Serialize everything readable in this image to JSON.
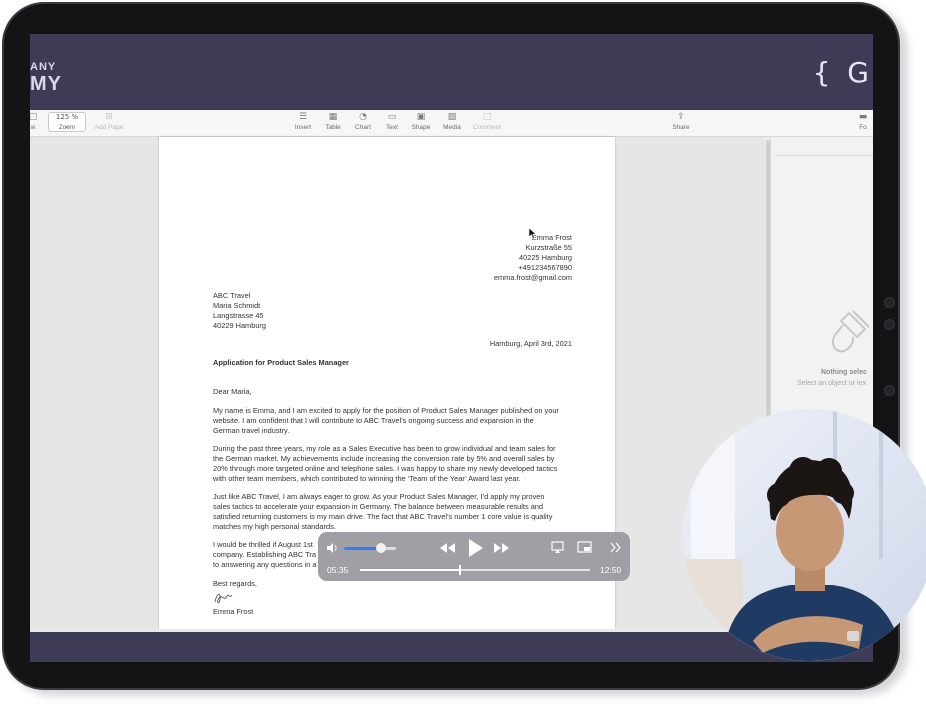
{
  "brand": {
    "left_line1": "ANY",
    "left_line2": "MY",
    "right_glyphs": "{ G"
  },
  "toolbar": {
    "zoom_value": "125 % ⌄",
    "items": [
      {
        "key": "view",
        "label": "w",
        "icon": "sidebar-icon",
        "glyph": "▢"
      },
      {
        "key": "zoom",
        "label": "Zoom",
        "icon": "zoom-select"
      },
      {
        "key": "add_page",
        "label": "Add Page",
        "icon": "add-page-icon",
        "glyph": "⊞",
        "disabled": true
      },
      {
        "key": "insert",
        "label": "Insert",
        "icon": "insert-icon",
        "glyph": "☰"
      },
      {
        "key": "table",
        "label": "Table",
        "icon": "table-icon",
        "glyph": "▦"
      },
      {
        "key": "chart",
        "label": "Chart",
        "icon": "chart-icon",
        "glyph": "◔"
      },
      {
        "key": "text",
        "label": "Text",
        "icon": "text-box-icon",
        "glyph": "▭"
      },
      {
        "key": "shape",
        "label": "Shape",
        "icon": "shape-icon",
        "glyph": "▣"
      },
      {
        "key": "media",
        "label": "Media",
        "icon": "media-icon",
        "glyph": "▧"
      },
      {
        "key": "comment",
        "label": "Comment",
        "icon": "comment-icon",
        "glyph": "□",
        "disabled": true
      },
      {
        "key": "share",
        "label": "Share",
        "icon": "share-icon",
        "glyph": "⇪"
      },
      {
        "key": "format",
        "label": "Fo",
        "icon": "format-icon",
        "glyph": "▬"
      }
    ]
  },
  "letter": {
    "sender": [
      "Emma Frost",
      "Kurzstraße 55",
      "40225 Hamburg",
      "+491234567890",
      "emma.frost@gmail.com"
    ],
    "recipient": [
      "ABC Travel",
      "Maria Schmidt",
      "Langstrasse 45",
      "40229 Hamburg"
    ],
    "date": "Hamburg, April 3rd, 2021",
    "subject": "Application for Product Sales Manager",
    "salutation": "Dear Maria,",
    "paragraphs": [
      [
        "My name is Emma, and I am excited to apply for the position of Product Sales Manager published on your",
        "website. I am confident that I will contribute to ABC Travel’s ongoing success and expansion in the",
        "German travel industry."
      ],
      [
        "During the past three years, my role as a Sales Executive has been to grow individual and team sales for",
        "the German market. My achievements include increasing the conversion rate by 5% and overall sales by",
        "20% through more targeted online and telephone sales. I was happy to share my newly developed tactics",
        "with other team members, which contributed to winning the ‘Team of the Year’ Award last year."
      ],
      [
        "Just like ABC Travel, I am always eager to grow. As your Product Sales Manager, I’d apply my proven",
        "sales tactics to accelerate your expansion in Germany. The balance between measurable results and",
        "satisfied returning customers is my main drive. The fact that ABC Travel’s number 1 core value is quality",
        "matches my high personal standards."
      ],
      [
        "I would be thrilled if August 1st",
        "company. Establishing ABC Tra",
        "to answering any questions in a"
      ]
    ],
    "closing": "Best regards,",
    "signature_name": "Emma Frost"
  },
  "sidebar": {
    "title": "Nothing selec",
    "subtitle": "Select an object or tex"
  },
  "player": {
    "elapsed": "05:35",
    "total": "12:50",
    "progress": 0.435,
    "volume": 0.72,
    "icons": [
      "speaker-icon",
      "rewind-icon",
      "play-icon",
      "fast-forward-icon",
      "airplay-icon",
      "picture-in-picture-icon",
      "more-chevron-icon"
    ]
  },
  "colors": {
    "screen_bg": "#3e3b56",
    "volume_accent": "#2f80ff",
    "device_frame": "#141416"
  }
}
